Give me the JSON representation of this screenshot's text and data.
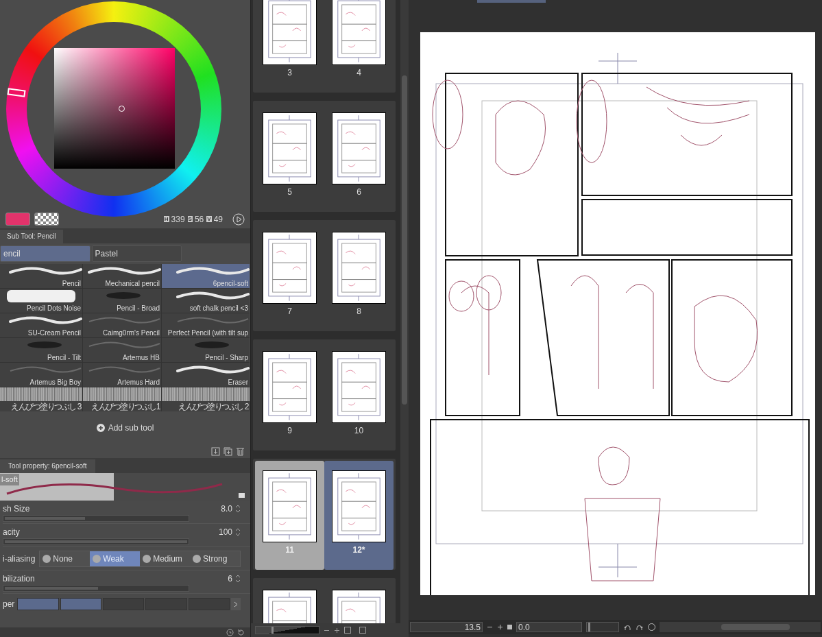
{
  "color_panel": {
    "hsv": [
      {
        "label": "H",
        "value": "339"
      },
      {
        "label": "S",
        "value": "56"
      },
      {
        "label": "V",
        "value": "49"
      }
    ]
  },
  "sub_tool": {
    "title": "Sub Tool: Pencil",
    "groups": [
      {
        "label": "encil",
        "selected": true
      },
      {
        "label": "Pastel",
        "selected": false
      }
    ],
    "brushes": [
      {
        "name": "Pencil",
        "kind": "stroke",
        "selected": false
      },
      {
        "name": "Mechanical pencil",
        "kind": "stroke",
        "selected": false
      },
      {
        "name": "6pencil-soft",
        "kind": "stroke",
        "selected": true
      },
      {
        "name": "Pencil Dots Noise",
        "kind": "blob",
        "selected": false
      },
      {
        "name": "Pencil - Broad",
        "kind": "smudge",
        "selected": false
      },
      {
        "name": "soft chalk pencil <3",
        "kind": "stroke",
        "selected": false
      },
      {
        "name": "SU-Cream Pencil",
        "kind": "stroke",
        "selected": false
      },
      {
        "name": "Caimg0rm's Pencil",
        "kind": "faint",
        "selected": false
      },
      {
        "name": "Perfect Pencil (with tilt sup",
        "kind": "faint",
        "selected": false
      },
      {
        "name": "Pencil - Tilt",
        "kind": "smudge",
        "selected": false
      },
      {
        "name": "Artemus HB",
        "kind": "faint",
        "selected": false
      },
      {
        "name": "Pencil - Sharp",
        "kind": "smudge",
        "selected": false
      },
      {
        "name": "Artemus Big Boy",
        "kind": "faint",
        "selected": false
      },
      {
        "name": "Artemus Hard",
        "kind": "faint",
        "selected": false
      },
      {
        "name": "Eraser",
        "kind": "stroke",
        "selected": false
      },
      {
        "name": "えんぴつ塗りつぶし 3",
        "kind": "texture",
        "selected": false
      },
      {
        "name": "えんぴつ塗りつぶし1",
        "kind": "texture",
        "selected": false
      },
      {
        "name": "えんぴつ塗りつぶし 2",
        "kind": "texture",
        "selected": false
      }
    ],
    "add_button": "Add sub tool"
  },
  "tool_property": {
    "title": "Tool property: 6pencil-soft",
    "preview_label": "l-soft",
    "rows": [
      {
        "kind": "slider",
        "label": "sh Size",
        "value": "8.0",
        "level": 0.44
      },
      {
        "kind": "slider",
        "label": "acity",
        "value": "100",
        "level": 1
      },
      {
        "kind": "radio",
        "label": "i-aliasing",
        "options": [
          {
            "label": "None",
            "selected": false
          },
          {
            "label": "Weak",
            "selected": true
          },
          {
            "label": "Medium",
            "selected": false
          },
          {
            "label": "Strong",
            "selected": false
          }
        ]
      },
      {
        "kind": "slider",
        "label": "bilization",
        "value": "6",
        "level": 0.51
      },
      {
        "kind": "swatches",
        "label": "per",
        "cells": [
          {
            "selected": true
          },
          {
            "selected": true
          },
          {
            "selected": false
          },
          {
            "selected": false
          },
          {
            "selected": false
          }
        ]
      }
    ]
  },
  "pages": [
    {
      "selected": false,
      "items": [
        {
          "label": "3",
          "active": false
        },
        {
          "label": "4",
          "active": false
        }
      ]
    },
    {
      "selected": false,
      "items": [
        {
          "label": "5",
          "active": false
        },
        {
          "label": "6",
          "active": false
        }
      ]
    },
    {
      "selected": false,
      "items": [
        {
          "label": "7",
          "active": false
        },
        {
          "label": "8",
          "active": false
        }
      ]
    },
    {
      "selected": false,
      "items": [
        {
          "label": "9",
          "active": false
        },
        {
          "label": "10",
          "active": false
        }
      ]
    },
    {
      "selected": true,
      "items": [
        {
          "label": "11",
          "active": false
        },
        {
          "label": "12*",
          "active": true
        }
      ]
    },
    {
      "selected": false,
      "items": [
        {
          "active": false
        },
        {
          "active": false
        }
      ]
    }
  ],
  "thumbnail_size": {
    "level": 0.25
  },
  "navigator": {
    "zoom": "13.5",
    "rotation": "0.0",
    "rotation_slider": {
      "level": 0.05
    }
  }
}
